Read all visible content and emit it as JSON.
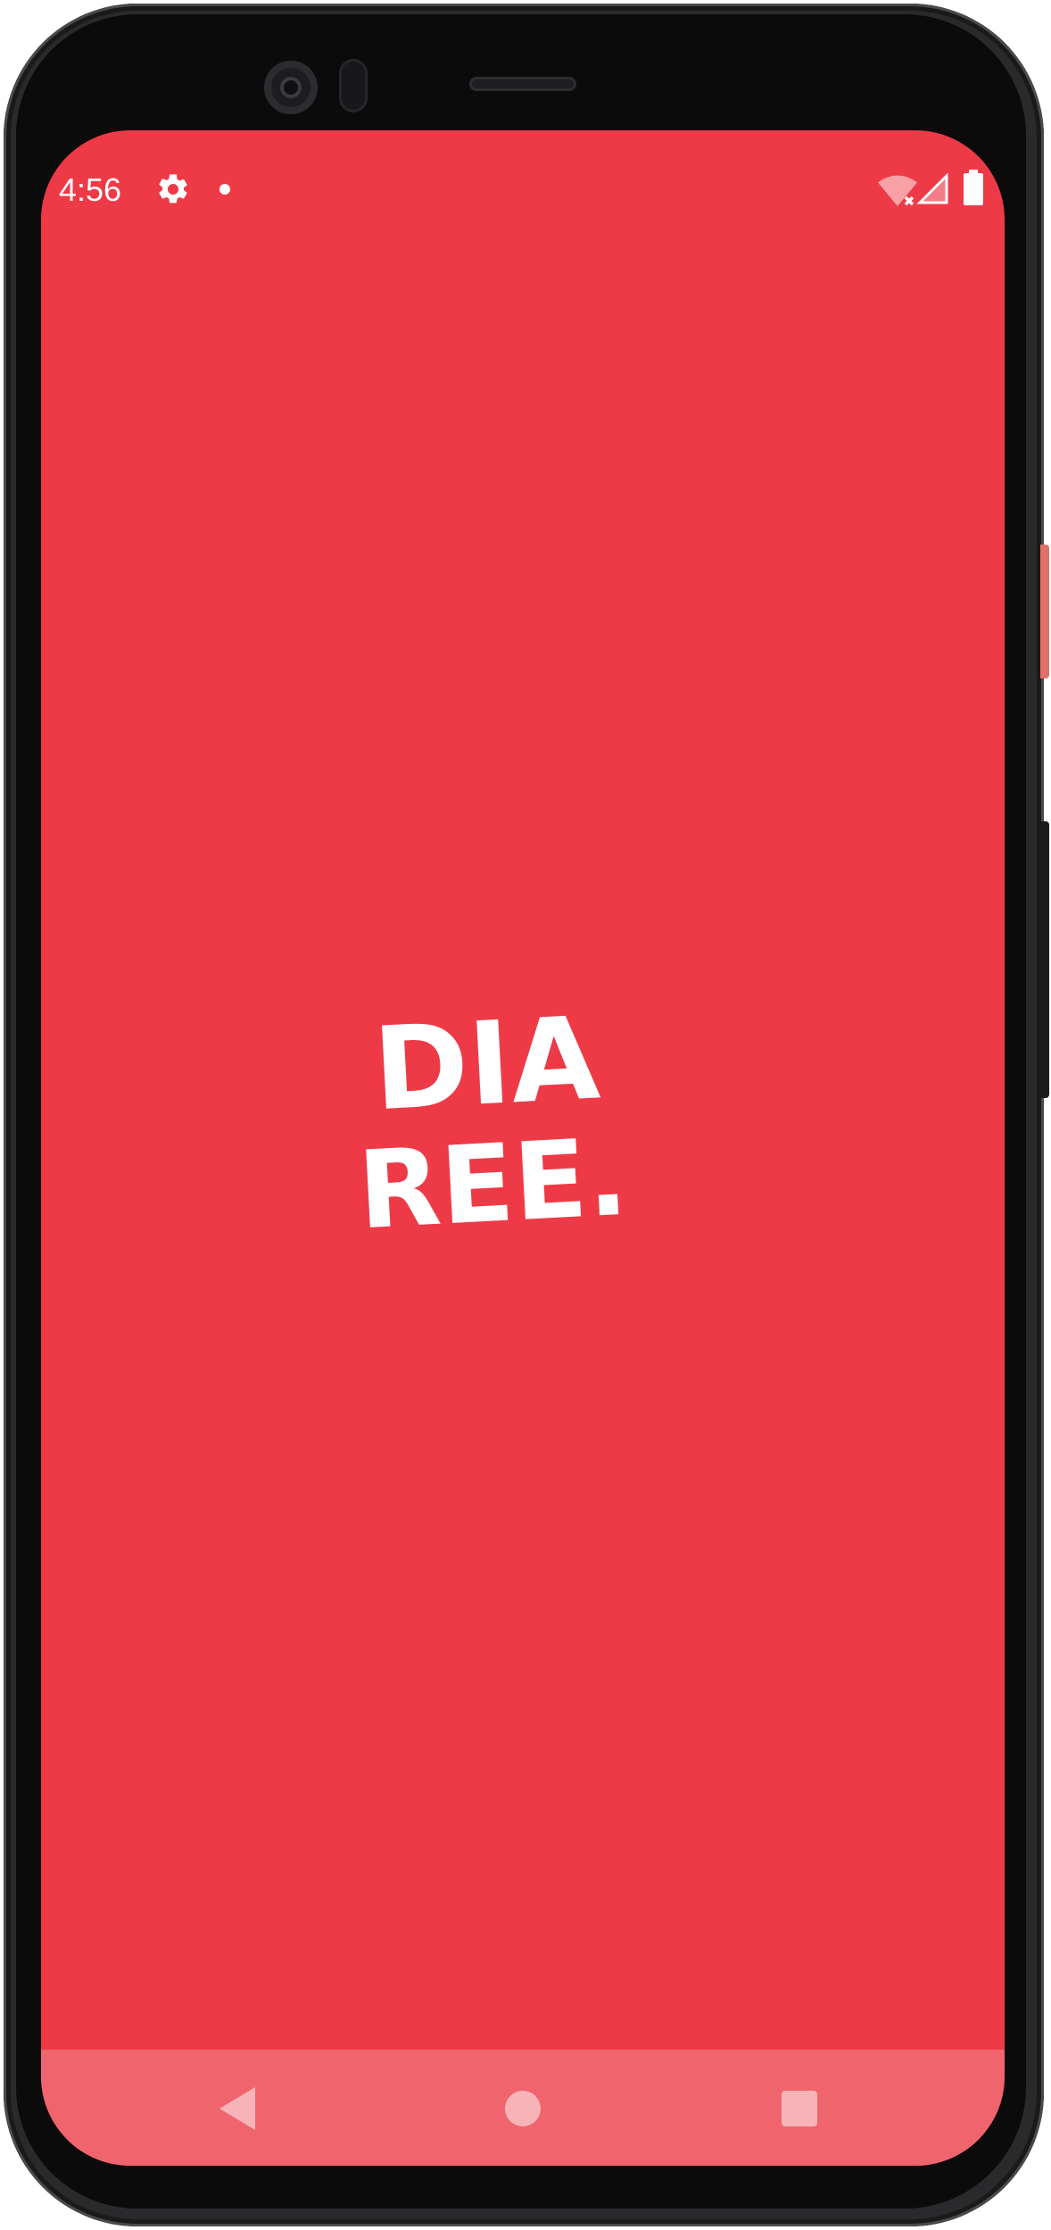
{
  "status_bar": {
    "time": "4:56",
    "icons": [
      "gear-icon",
      "notification-dot-icon",
      "wifi-off-icon",
      "signal-icon",
      "battery-icon"
    ]
  },
  "splash": {
    "logo_line1": "DIA",
    "logo_line2": "REE."
  },
  "nav_bar": {
    "buttons": [
      "back",
      "home",
      "recents"
    ]
  },
  "colors": {
    "background": "#ee3a47",
    "nav_bar": "#f0646d",
    "logo": "#ffffff"
  }
}
